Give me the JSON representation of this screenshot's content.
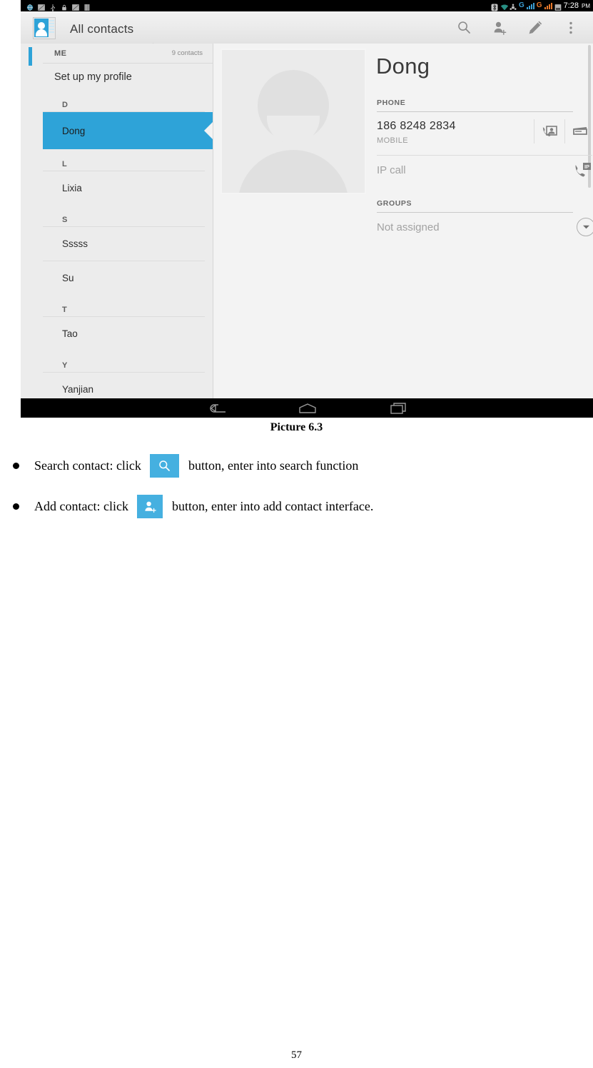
{
  "statusbar": {
    "time": "7:28",
    "meridiem": "PM",
    "left_icons": [
      "browser-icon",
      "screenshot-icon",
      "usb-icon",
      "lock-icon",
      "screenshot-icon-2",
      "sim-icon"
    ],
    "right_icons": [
      "bluetooth-icon",
      "wifi-icon",
      "gps-icon",
      "signal-g-blue-icon",
      "signal-g-orange-icon",
      "battery-icon"
    ],
    "network_label_1": "G",
    "network_label_2": "G"
  },
  "actionbar": {
    "title": "All contacts",
    "app_icon": "contacts-app-icon",
    "actions": [
      {
        "name": "search-icon",
        "label": "Search"
      },
      {
        "name": "add-contact-icon",
        "label": "Add contact"
      },
      {
        "name": "edit-pencil-icon",
        "label": "Edit"
      },
      {
        "name": "overflow-menu-icon",
        "label": "More options"
      }
    ]
  },
  "list": {
    "me_label": "ME",
    "contact_count": "9 contacts",
    "profile_label": "Set up my profile",
    "entries": [
      {
        "type": "section",
        "label": "D"
      },
      {
        "type": "contact",
        "label": "Dong",
        "selected": true
      },
      {
        "type": "section",
        "label": "L"
      },
      {
        "type": "contact",
        "label": "Lixia",
        "selected": false
      },
      {
        "type": "section",
        "label": "S"
      },
      {
        "type": "contact",
        "label": "Sssss",
        "selected": false
      },
      {
        "type": "contact",
        "label": "Su",
        "selected": false
      },
      {
        "type": "section",
        "label": "T"
      },
      {
        "type": "contact",
        "label": "Tao",
        "selected": false
      },
      {
        "type": "section",
        "label": "Y"
      },
      {
        "type": "contact",
        "label": "Yanjian",
        "selected": false
      }
    ]
  },
  "detail": {
    "avatar": "contact-avatar-placeholder",
    "name": "Dong",
    "phone_section_label": "PHONE",
    "phone_number": "186 8248 2834",
    "phone_type": "MOBILE",
    "phone_actions": [
      {
        "name": "video-call-icon"
      },
      {
        "name": "message-icon"
      }
    ],
    "ip_call_label": "IP call",
    "ip_call_icon": "ip-call-icon",
    "groups_section_label": "GROUPS",
    "group_value": "Not assigned",
    "group_chevron_icon": "chevron-down-circle-icon"
  },
  "navbar": {
    "buttons": [
      {
        "name": "back-button"
      },
      {
        "name": "home-button"
      },
      {
        "name": "recents-button"
      }
    ]
  },
  "document": {
    "caption": "Picture 6.3",
    "bullets": [
      {
        "before": "Search contact: click ",
        "icon": "search-icon-button",
        "after": " button, enter into search function"
      },
      {
        "before": "Add contact: click ",
        "icon": "add-contact-icon-button",
        "after": " button, enter into add contact interface."
      }
    ],
    "page_number": "57"
  },
  "colors": {
    "accent_blue": "#2ea3d8",
    "doc_button_blue": "#45b0e0",
    "signal_blue": "#3b9fd4",
    "signal_orange": "#e8782a"
  }
}
